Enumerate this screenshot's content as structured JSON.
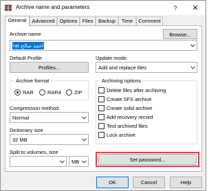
{
  "window": {
    "title": "Archive name and parameters",
    "help_glyph": "?",
    "close_glyph": "✕"
  },
  "tabs": [
    "General",
    "Advanced",
    "Options",
    "Files",
    "Backup",
    "Time",
    "Comment"
  ],
  "archive_name": {
    "label": "Archive name",
    "value": "احمد صالح.rar",
    "browse_label": "Browse..."
  },
  "default_profile": {
    "label": "Default Profile",
    "button_label": "Profiles..."
  },
  "update_mode": {
    "label": "Update mode",
    "selected": "Add and replace files"
  },
  "archive_format": {
    "label": "Archive format",
    "options": [
      "RAR",
      "RAR4",
      "ZIP"
    ],
    "selected": "RAR"
  },
  "compression": {
    "label": "Compression method",
    "selected": "Normal"
  },
  "dictionary": {
    "label": "Dictionary size",
    "selected": "32 MB"
  },
  "split": {
    "label": "Split to volumes, size",
    "value": "",
    "unit": "MB"
  },
  "archiving_options": {
    "label": "Archiving options",
    "items": [
      {
        "label": "Delete files after archiving",
        "checked": false
      },
      {
        "label": "Create SFX archive",
        "checked": false
      },
      {
        "label": "Create solid archive",
        "checked": false
      },
      {
        "label": "Add recovery record",
        "checked": false
      },
      {
        "label": "Test archived files",
        "checked": false
      },
      {
        "label": "Lock archive",
        "checked": false
      }
    ]
  },
  "set_password_label": "Set password...",
  "footer": {
    "ok_label": "OK",
    "cancel_label": "Cancel",
    "help_label": "Help"
  },
  "colors": {
    "selection": "#0078d7",
    "highlight": "#e04040",
    "window_bg": "#f0f0f0"
  }
}
